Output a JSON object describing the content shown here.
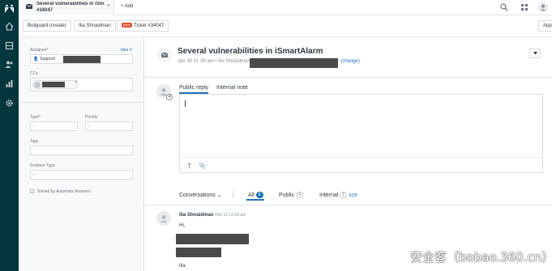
{
  "tab": {
    "title_line1": "Several vulnerabilities in iSm...",
    "title_line2": "#34047",
    "close": "×",
    "add_label": "+ Add"
  },
  "breadcrumbs": [
    {
      "label": "Bullguard (create)"
    },
    {
      "label": "Ilia Shnaidman"
    },
    {
      "badge": "open",
      "label": "Ticket #34047"
    }
  ],
  "apps_label": "Apps",
  "properties": {
    "assignee_label": "Assignee*",
    "take_it": "take it",
    "assignee_value": "Support/",
    "ccs_label": "CCs",
    "cc_remove": "×",
    "type_label": "Type*",
    "type_value": "-",
    "priority_label": "Priority",
    "priority_value": "-",
    "tags_label": "Tags",
    "problem_type_label": "Problem Type",
    "problem_type_value": "-",
    "solved_by_label": "Solved by Automatic Answers"
  },
  "ticket": {
    "subject": "Several vulnerabilities in iSmartAlarm",
    "date": "Jan 30 01:36 am",
    "bullet": "•",
    "requester": "Ilia Shnaidman",
    "change_link": "(change)"
  },
  "reply": {
    "public_tab": "Public reply",
    "internal_tab": "Internal note",
    "text_icon": "T",
    "attach_icon": "📎"
  },
  "filters": {
    "conversations": "Conversations ⌄",
    "all": "All",
    "all_count": "8",
    "public": "Public",
    "public_count": "4",
    "internal": "Internal",
    "internal_count": "1",
    "internal_extra": "sce"
  },
  "comment": {
    "author": "Ilia Shnaidman",
    "time": "Feb 12 12:23 am",
    "greeting": "Hi,",
    "closing": "Ilia"
  },
  "avatar_badge": "4",
  "watermark": "安全客（bobao.360.cn）",
  "colors": {
    "rail": "#03363d",
    "accent": "#1f73b7",
    "open_badge": "#e34f32"
  }
}
